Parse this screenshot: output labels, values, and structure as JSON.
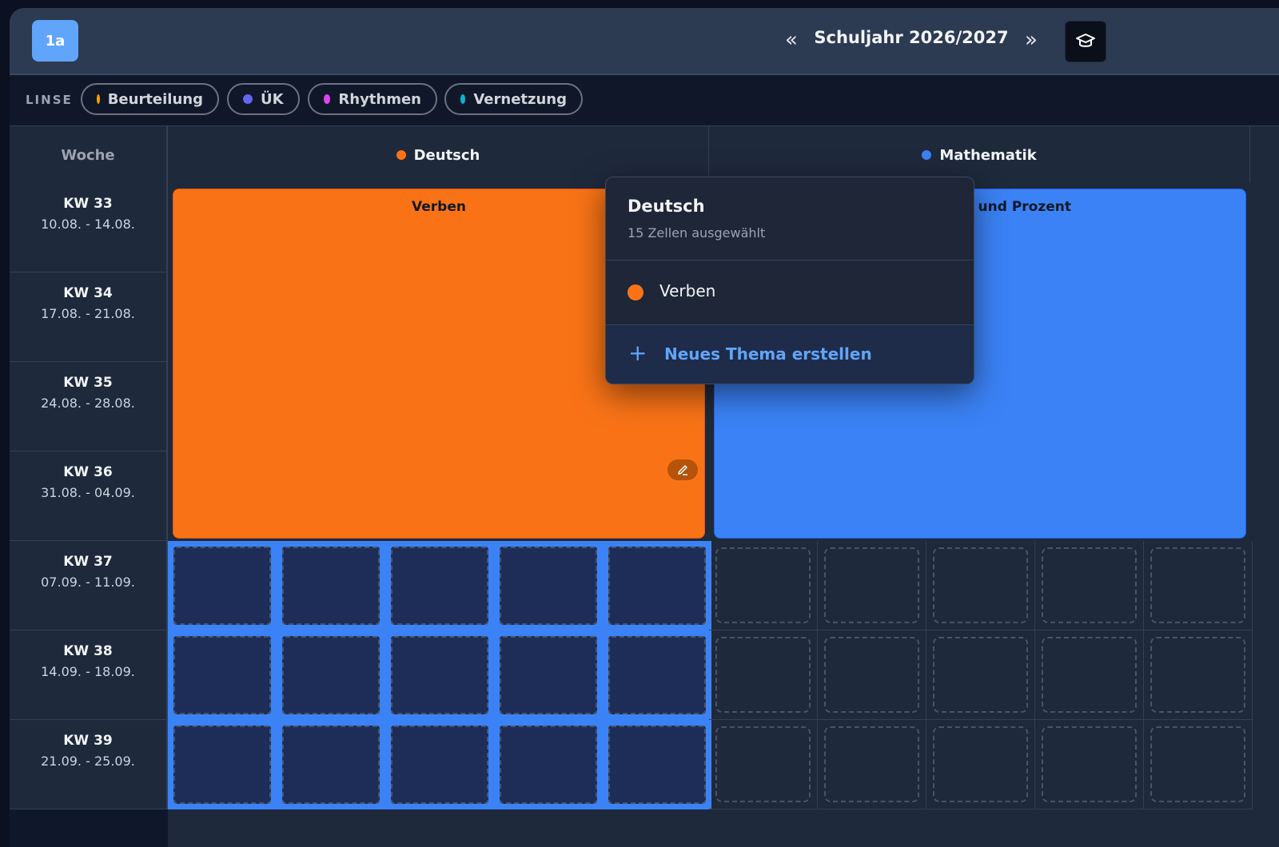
{
  "header": {
    "class_label": "1a",
    "prev_label": "«",
    "next_label": "»",
    "school_year": "Schuljahr 2026/2027",
    "cap_icon": "graduation-cap-icon"
  },
  "lens": {
    "label": "LINSE",
    "chips": [
      {
        "label": "Beurteilung",
        "color": "#f59e0b"
      },
      {
        "label": "ÜK",
        "color": "#6366f1"
      },
      {
        "label": "Rhythmen",
        "color": "#d946ef"
      },
      {
        "label": "Vernetzung",
        "color": "#06b6d4"
      }
    ]
  },
  "grid": {
    "week_header": "Woche",
    "subjects": [
      {
        "name": "Deutsch",
        "color": "#f97316"
      },
      {
        "name": "Mathematik",
        "color": "#3b82f6"
      }
    ],
    "weeks": [
      {
        "kw": "KW 33",
        "range": "10.08. - 14.08."
      },
      {
        "kw": "KW 34",
        "range": "17.08. - 21.08."
      },
      {
        "kw": "KW 35",
        "range": "24.08. - 28.08."
      },
      {
        "kw": "KW 36",
        "range": "31.08. - 04.09."
      },
      {
        "kw": "KW 37",
        "range": "07.09. - 11.09."
      },
      {
        "kw": "KW 38",
        "range": "14.09. - 18.09."
      },
      {
        "kw": "KW 39",
        "range": "21.09. - 25.09."
      }
    ],
    "topics": [
      {
        "title": "Verben",
        "color": "#f97316"
      },
      {
        "title": "en und Prozent",
        "color": "#3b82f6"
      }
    ]
  },
  "popover": {
    "title": "Deutsch",
    "subtitle": "15 Zellen ausgewählt",
    "item_label": "Verben",
    "item_color": "#f97316",
    "new_label": "Neues Thema erstellen",
    "plus": "+"
  }
}
